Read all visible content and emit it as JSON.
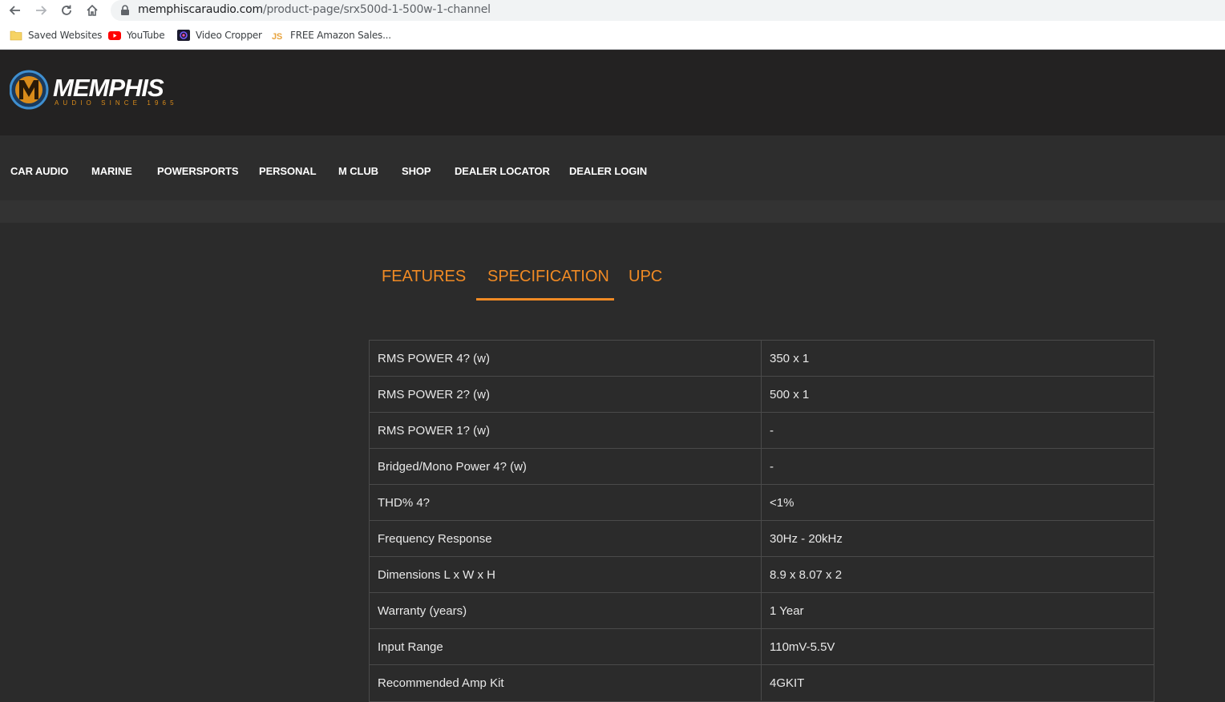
{
  "browser": {
    "url_host": "memphiscaraudio.com",
    "url_path": "/product-page/srx500d-1-500w-1-channel",
    "bookmarks": [
      {
        "label": "Saved Websites",
        "icon": "folder-icon"
      },
      {
        "label": "YouTube",
        "icon": "youtube-icon"
      },
      {
        "label": "Video Cropper",
        "icon": "video-cropper-icon"
      },
      {
        "label": "FREE Amazon Sales...",
        "icon": "js-icon"
      }
    ]
  },
  "site": {
    "logo_text": "MEMPHIS",
    "logo_tagline": "AUDIO SINCE 1965",
    "nav": [
      "CAR AUDIO",
      "MARINE",
      "POWERSPORTS",
      "PERSONAL",
      "M CLUB",
      "SHOP",
      "DEALER LOCATOR",
      "DEALER LOGIN"
    ]
  },
  "tabs": {
    "items": [
      "FEATURES",
      "SPECIFICATION",
      "UPC"
    ],
    "active": "SPECIFICATION",
    "accent_color": "#f08a24"
  },
  "specs": [
    {
      "key": "RMS POWER 4? (w)",
      "value": "350 x 1"
    },
    {
      "key": "RMS POWER 2? (w)",
      "value": "500 x 1"
    },
    {
      "key": "RMS POWER 1? (w)",
      "value": "-"
    },
    {
      "key": "Bridged/Mono Power 4? (w)",
      "value": "-"
    },
    {
      "key": "THD% 4?",
      "value": "<1%"
    },
    {
      "key": "Frequency Response",
      "value": "30Hz - 20kHz"
    },
    {
      "key": "Dimensions L x W x H",
      "value": "8.9 x 8.07 x 2"
    },
    {
      "key": "Warranty (years)",
      "value": "1 Year"
    },
    {
      "key": "Input Range",
      "value": "110mV-5.5V"
    },
    {
      "key": "Recommended Amp Kit",
      "value": "4GKIT"
    }
  ]
}
